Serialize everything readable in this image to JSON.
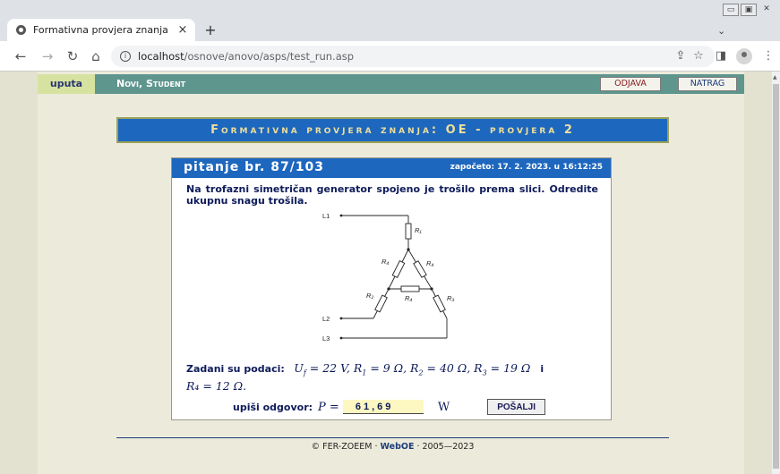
{
  "browser": {
    "tab_title": "Formativna provjera znanja",
    "tab_close": "×",
    "new_tab": "+",
    "url_host": "localhost",
    "url_path": "/osnove/anovo/asps/test_run.asp"
  },
  "nav": {
    "uputa": "uputa",
    "user": "Novi, Student",
    "odjava": "ODJAVA",
    "natrag": "NATRAG"
  },
  "banner": {
    "title": "Formativna provjera znanja: OE - provjera 2"
  },
  "question": {
    "number": "pitanje br. 87/103",
    "started": "započeto: 17. 2. 2023. u 16:12:25",
    "text": "Na trofazni simetričan generator spojeno je trošilo prema slici. Odredite ukupnu snagu trošila.",
    "givens_label": "Zadani su podaci:",
    "givens_values": [
      "U",
      "f",
      " = 22 V,   R",
      "1",
      " = 9 Ω,   R",
      "2",
      " = 40 Ω,   R",
      "3",
      " = 19 Ω"
    ],
    "givens_and": "i",
    "givens_last": "R₄ = 12 Ω."
  },
  "circuit": {
    "labels": {
      "l1": "L1",
      "l2": "L2",
      "l3": "L3",
      "r1": "R₁",
      "r2": "R₂",
      "r3": "R₃",
      "r4a": "R₄",
      "r4b": "R₄",
      "r4c": "R₄"
    }
  },
  "answer": {
    "label": "upiši odgovor:",
    "var": "P =",
    "value": "61,69",
    "unit": "W",
    "submit": "POŠALJI"
  },
  "footer": {
    "left": "© FER-ZOEEM · ",
    "brand": "WebOE",
    "right": " · 2005—2023"
  }
}
